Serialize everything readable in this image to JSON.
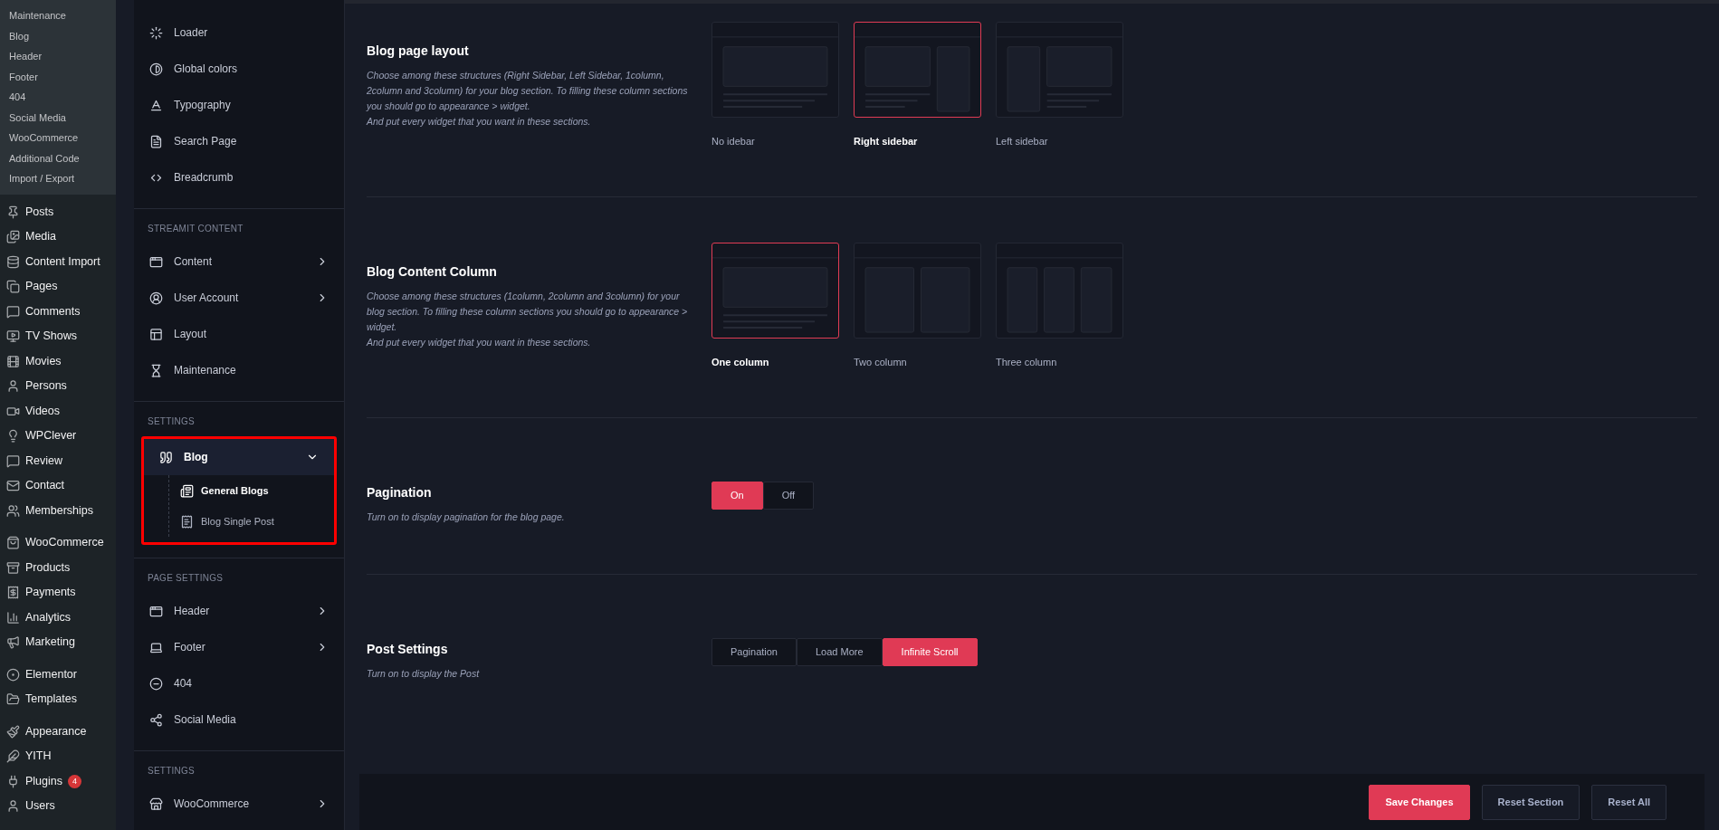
{
  "wp_submenu": [
    "Maintenance",
    "Blog",
    "Header",
    "Footer",
    "404",
    "Social Media",
    "WooCommerce",
    "Additional Code",
    "Import / Export"
  ],
  "wp_menu_groups": [
    [
      {
        "label": "Posts"
      },
      {
        "label": "Media"
      },
      {
        "label": "Content Import"
      },
      {
        "label": "Pages"
      },
      {
        "label": "Comments"
      },
      {
        "label": "TV Shows"
      },
      {
        "label": "Movies"
      },
      {
        "label": "Persons"
      },
      {
        "label": "Videos"
      },
      {
        "label": "WPClever"
      },
      {
        "label": "Review"
      },
      {
        "label": "Contact"
      },
      {
        "label": "Memberships"
      }
    ],
    [
      {
        "label": "WooCommerce"
      },
      {
        "label": "Products"
      },
      {
        "label": "Payments"
      },
      {
        "label": "Analytics"
      },
      {
        "label": "Marketing"
      }
    ],
    [
      {
        "label": "Elementor"
      },
      {
        "label": "Templates"
      }
    ],
    [
      {
        "label": "Appearance"
      },
      {
        "label": "YITH"
      },
      {
        "label": "Plugins",
        "badge": "4"
      },
      {
        "label": "Users"
      }
    ]
  ],
  "options_sidebar": [
    {
      "items": [
        {
          "label": "Loader",
          "has_arrow": false
        },
        {
          "label": "Global colors",
          "has_arrow": false
        },
        {
          "label": "Typography",
          "has_arrow": false
        },
        {
          "label": "Search Page",
          "has_arrow": false
        },
        {
          "label": "Breadcrumb",
          "has_arrow": false
        }
      ]
    },
    {
      "heading": "STREAMIT CONTENT",
      "items": [
        {
          "label": "Content",
          "has_arrow": true
        },
        {
          "label": "User Account",
          "has_arrow": true
        },
        {
          "label": "Layout",
          "has_arrow": false
        },
        {
          "label": "Maintenance",
          "has_arrow": false
        }
      ]
    },
    {
      "heading": "SETTINGS",
      "highlighted": true,
      "items": [
        {
          "label": "Blog",
          "has_arrow": true,
          "expanded": true,
          "children": [
            {
              "label": "General Blogs",
              "selected": true
            },
            {
              "label": "Blog Single Post",
              "selected": false
            }
          ]
        }
      ]
    },
    {
      "heading": "PAGE SETTINGS",
      "items": [
        {
          "label": "Header",
          "has_arrow": true
        },
        {
          "label": "Footer",
          "has_arrow": true
        },
        {
          "label": "404",
          "has_arrow": false
        },
        {
          "label": "Social Media",
          "has_arrow": false
        }
      ]
    },
    {
      "heading": "SETTINGS",
      "items": [
        {
          "label": "WooCommerce",
          "has_arrow": true
        }
      ]
    }
  ],
  "sections": [
    {
      "kind": "layout",
      "title": "Blog page layout",
      "description": "Choose among these structures (Right Sidebar, Left Sidebar, 1column, 2column and 3column) for your blog section. To filling these column sections you should go to appearance > widget.\nAnd put every widget that you want in these sections.",
      "options": [
        {
          "kind": "no-sidebar",
          "label": "No idebar",
          "selected": false
        },
        {
          "kind": "right-sidebar",
          "label": "Right sidebar",
          "selected": true
        },
        {
          "kind": "left-sidebar",
          "label": "Left sidebar",
          "selected": false
        }
      ]
    },
    {
      "kind": "layout",
      "title": "Blog Content Column",
      "description": "Choose among these structures (1column, 2column and 3column) for your blog section. To filling these column sections you should go to appearance > widget.\nAnd put every widget that you want in these sections.",
      "options": [
        {
          "kind": "one-column",
          "label": "One column",
          "selected": true
        },
        {
          "kind": "two-column",
          "label": "Two column",
          "selected": false
        },
        {
          "kind": "three-column",
          "label": "Three column",
          "selected": false
        }
      ]
    },
    {
      "kind": "buttons",
      "title": "Pagination",
      "description": "Turn on to display pagination for the blog page.",
      "options": [
        {
          "label": "On",
          "selected": true
        },
        {
          "label": "Off",
          "selected": false
        }
      ]
    },
    {
      "kind": "buttons",
      "title": "Post Settings",
      "description": "Turn on to display the Post",
      "options": [
        {
          "label": "Pagination",
          "selected": false
        },
        {
          "label": "Load More",
          "selected": false
        },
        {
          "label": "Infinite Scroll",
          "selected": true
        }
      ]
    }
  ],
  "footer_buttons": [
    {
      "label": "Save Changes",
      "kind": "primary"
    },
    {
      "label": "Reset Section",
      "kind": "secondary"
    },
    {
      "label": "Reset All",
      "kind": "secondary"
    }
  ]
}
